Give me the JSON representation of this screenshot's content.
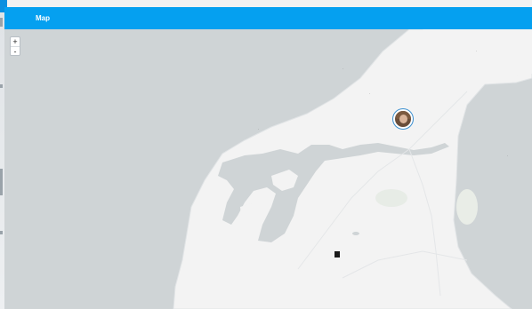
{
  "app": {
    "title": "Map"
  },
  "map": {
    "zoom_in_label": "+",
    "zoom_out_label": "-",
    "user_marker_label": "",
    "colors": {
      "water": "#cfd4d6",
      "land": "#f3f3f3",
      "bar": "#05a0f0"
    }
  }
}
